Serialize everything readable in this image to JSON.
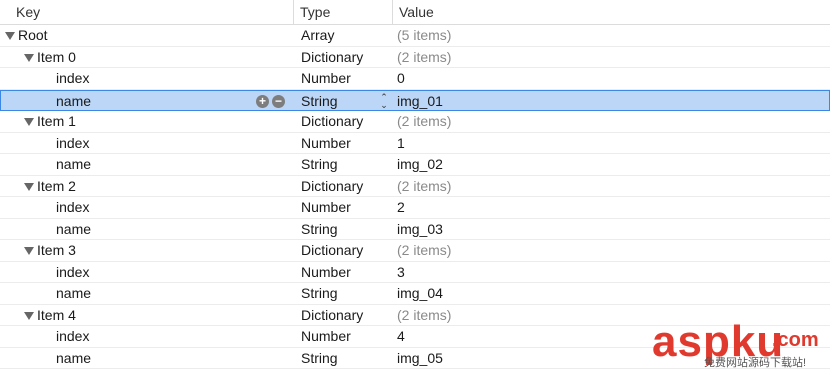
{
  "header": {
    "key": "Key",
    "type": "Type",
    "value": "Value"
  },
  "rows": [
    {
      "key": "Root",
      "type": "Array",
      "value": "(5 items)",
      "level": 0,
      "expandable": true,
      "muted": true,
      "selected": false
    },
    {
      "key": "Item 0",
      "type": "Dictionary",
      "value": "(2 items)",
      "level": 1,
      "expandable": true,
      "muted": true,
      "selected": false
    },
    {
      "key": "index",
      "type": "Number",
      "value": "0",
      "level": 2,
      "expandable": false,
      "muted": false,
      "selected": false
    },
    {
      "key": "name",
      "type": "String",
      "value": "img_01",
      "level": 2,
      "expandable": false,
      "muted": false,
      "selected": true
    },
    {
      "key": "Item 1",
      "type": "Dictionary",
      "value": "(2 items)",
      "level": 1,
      "expandable": true,
      "muted": true,
      "selected": false
    },
    {
      "key": "index",
      "type": "Number",
      "value": "1",
      "level": 2,
      "expandable": false,
      "muted": false,
      "selected": false
    },
    {
      "key": "name",
      "type": "String",
      "value": "img_02",
      "level": 2,
      "expandable": false,
      "muted": false,
      "selected": false
    },
    {
      "key": "Item 2",
      "type": "Dictionary",
      "value": "(2 items)",
      "level": 1,
      "expandable": true,
      "muted": true,
      "selected": false
    },
    {
      "key": "index",
      "type": "Number",
      "value": "2",
      "level": 2,
      "expandable": false,
      "muted": false,
      "selected": false
    },
    {
      "key": "name",
      "type": "String",
      "value": "img_03",
      "level": 2,
      "expandable": false,
      "muted": false,
      "selected": false
    },
    {
      "key": "Item 3",
      "type": "Dictionary",
      "value": "(2 items)",
      "level": 1,
      "expandable": true,
      "muted": true,
      "selected": false
    },
    {
      "key": "index",
      "type": "Number",
      "value": "3",
      "level": 2,
      "expandable": false,
      "muted": false,
      "selected": false
    },
    {
      "key": "name",
      "type": "String",
      "value": "img_04",
      "level": 2,
      "expandable": false,
      "muted": false,
      "selected": false
    },
    {
      "key": "Item 4",
      "type": "Dictionary",
      "value": "(2 items)",
      "level": 1,
      "expandable": true,
      "muted": true,
      "selected": false
    },
    {
      "key": "index",
      "type": "Number",
      "value": "4",
      "level": 2,
      "expandable": false,
      "muted": false,
      "selected": false
    },
    {
      "key": "name",
      "type": "String",
      "value": "img_05",
      "level": 2,
      "expandable": false,
      "muted": false,
      "selected": false
    }
  ],
  "icons": {
    "expand": "disclosure-triangle-icon",
    "add": "plus-circle-icon",
    "remove": "minus-circle-icon",
    "stepper": "up-down-stepper-icon"
  },
  "colors": {
    "selection_bg": "#bcd6f7",
    "selection_border": "#3b87e6",
    "muted_text": "#8a8a8a",
    "watermark": "#e03a2f"
  },
  "watermark": {
    "main": "asp",
    "main2": "ku",
    "dot": ".com",
    "sub": "免费网站源码下载站!"
  }
}
